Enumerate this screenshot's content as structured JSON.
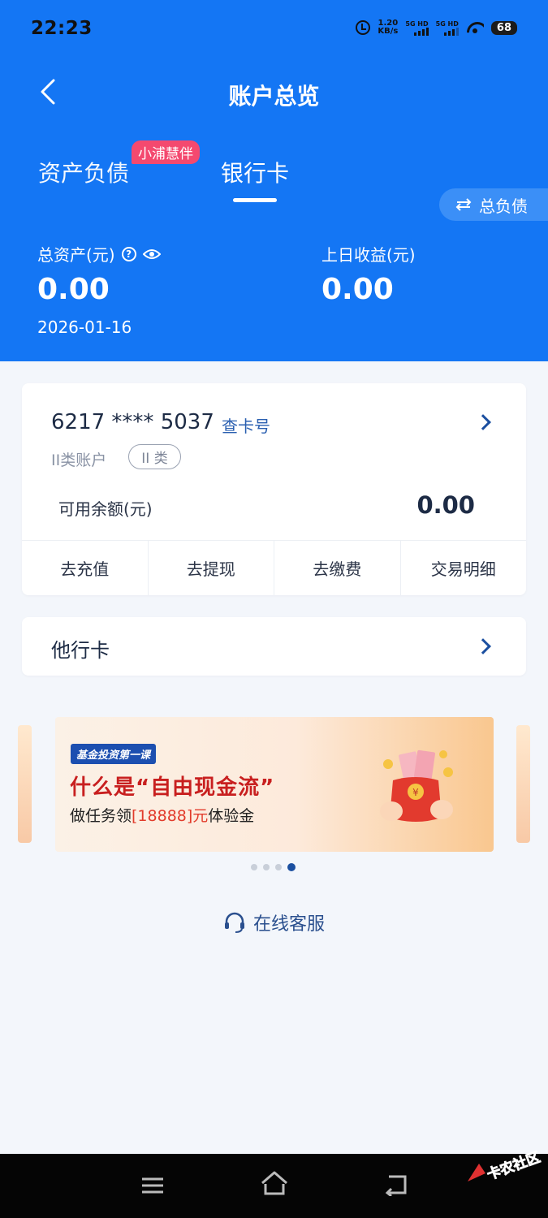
{
  "status_bar": {
    "time": "22:23",
    "net_speed_value": "1.20",
    "net_speed_unit": "KB/s",
    "sim1_label": "5G HD",
    "sim2_label": "5G HD",
    "battery": "68"
  },
  "nav": {
    "title": "账户总览",
    "back_icon": "chevron-left-icon"
  },
  "tabs": {
    "assets_label": "资产负债",
    "promo_badge": "小浦慧伴",
    "cards_label": "银行卡",
    "active_tab": "银行卡"
  },
  "debt_pill": {
    "label": "总负债",
    "icon": "swap-icon"
  },
  "summary": {
    "total_assets_label": "总资产(元)",
    "total_assets_value": "0.00",
    "date": "2026-01-16",
    "yesterday_income_label": "上日收益(元)",
    "yesterday_income_value": "0.00"
  },
  "main_card": {
    "card_number": "6217 **** 5037",
    "query_label": "查卡号",
    "account_type": "II类账户",
    "account_tag": "II 类",
    "balance_label": "可用余额(元)",
    "balance_value": "0.00",
    "actions": [
      "去充值",
      "去提现",
      "去缴费",
      "交易明细"
    ]
  },
  "other_card": {
    "label": "他行卡"
  },
  "banner": {
    "tag": "基金投资第一课",
    "title": "什么是“自由现金流”",
    "sub_prefix": "做任务领",
    "sub_highlight": "[18888]元",
    "sub_suffix": "体验金",
    "page_count": 4,
    "active_page": 4
  },
  "service": {
    "label": "在线客服",
    "icon": "headset-icon"
  },
  "colors": {
    "header_blue": "#1476f4",
    "accent_dark_blue": "#1b4fa0",
    "badge_pink": "#f4496f",
    "banner_red": "#c81f1f"
  }
}
